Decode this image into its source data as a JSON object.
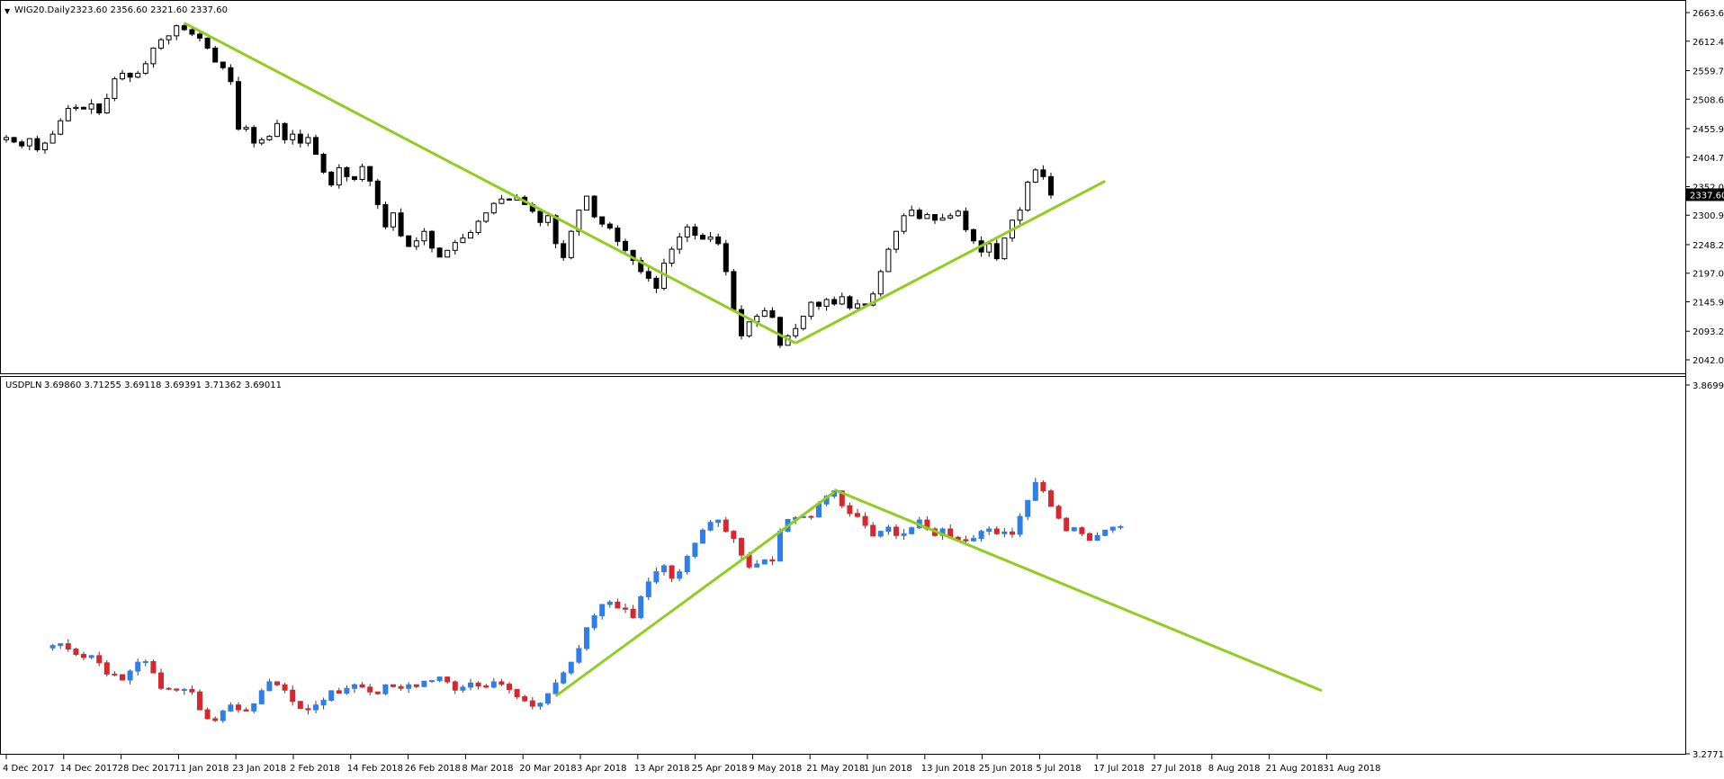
{
  "chart_data": [
    {
      "type": "candlestick",
      "title": "WIG20.Daily",
      "ohlc_text": "2323.60 2356.60 2321.60 2337.60",
      "current_price": "2337.60",
      "y_ticks": [
        "2663.60",
        "2612.45",
        "2559.70",
        "2508.60",
        "2455.90",
        "2404.75",
        "2352.05",
        "2300.90",
        "2248.20",
        "2197.05",
        "2145.90",
        "2093.20",
        "2042.05"
      ],
      "ylim": [
        2042.05,
        2663.6
      ],
      "bull_color": "#ffffff",
      "bear_color": "#000000",
      "trendline_color": "#8fce1f",
      "closes": [
        2440,
        2432,
        2425,
        2438,
        2418,
        2430,
        2446,
        2470,
        2492,
        2494,
        2491,
        2500,
        2484,
        2510,
        2545,
        2555,
        2548,
        2555,
        2572,
        2600,
        2615,
        2622,
        2640,
        2633,
        2625,
        2618,
        2600,
        2575,
        2565,
        2540,
        2455,
        2458,
        2430,
        2436,
        2442,
        2465,
        2436,
        2446,
        2430,
        2440,
        2410,
        2378,
        2355,
        2386,
        2370,
        2365,
        2388,
        2362,
        2320,
        2280,
        2305,
        2264,
        2245,
        2255,
        2272,
        2242,
        2226,
        2238,
        2252,
        2260,
        2270,
        2290,
        2305,
        2322,
        2330,
        2328,
        2333,
        2320,
        2308,
        2288,
        2300,
        2250,
        2225,
        2272,
        2310,
        2335,
        2298,
        2285,
        2278,
        2254,
        2238,
        2220,
        2200,
        2188,
        2170,
        2215,
        2240,
        2262,
        2280,
        2265,
        2258,
        2262,
        2250,
        2200,
        2132,
        2085,
        2110,
        2120,
        2130,
        2118,
        2068,
        2085,
        2098,
        2120,
        2145,
        2138,
        2150,
        2142,
        2155,
        2135,
        2142,
        2140,
        2160,
        2200,
        2240,
        2272,
        2300,
        2310,
        2295,
        2302,
        2292,
        2296,
        2300,
        2308,
        2275,
        2255,
        2235,
        2250,
        2223,
        2260,
        2292,
        2310,
        2360,
        2382,
        2370,
        2337
      ],
      "trendlines": [
        {
          "from": {
            "bar": 23,
            "price": 2645
          },
          "to": {
            "bar": 102,
            "price": 2072
          }
        },
        {
          "from": {
            "bar": 102,
            "price": 2072
          },
          "to": {
            "bar": 142,
            "price": 2362
          }
        }
      ]
    },
    {
      "type": "candlestick",
      "title": "USDPLN",
      "ohlc_text": "3.69860 3.71255 3.69118 3.69391 3.71362 3.69011",
      "y_ticks": [
        "3.86992",
        "3.27712"
      ],
      "ylim": [
        3.27712,
        3.86992
      ],
      "bull_color": "#2f7fe8",
      "bear_color": "#d8272d",
      "trendline_color": "#8fce1f",
      "closes": [
        3.438,
        3.441,
        3.432,
        3.423,
        3.418,
        3.421,
        3.409,
        3.39,
        3.389,
        3.38,
        3.395,
        3.41,
        3.411,
        3.392,
        3.366,
        3.365,
        3.363,
        3.364,
        3.36,
        3.33,
        3.315,
        3.312,
        3.328,
        3.338,
        3.33,
        3.328,
        3.34,
        3.362,
        3.377,
        3.372,
        3.363,
        3.344,
        3.332,
        3.33,
        3.338,
        3.346,
        3.362,
        3.358,
        3.366,
        3.372,
        3.368,
        3.36,
        3.357,
        3.372,
        3.369,
        3.366,
        3.372,
        3.369,
        3.378,
        3.379,
        3.385,
        3.377,
        3.363,
        3.368,
        3.375,
        3.37,
        3.368,
        3.377,
        3.373,
        3.364,
        3.352,
        3.345,
        3.336,
        3.341,
        3.357,
        3.375,
        3.392,
        3.41,
        3.433,
        3.468,
        3.488,
        3.507,
        3.511,
        3.501,
        3.499,
        3.485,
        3.52,
        3.545,
        3.562,
        3.572,
        3.551,
        3.562,
        3.588,
        3.61,
        3.632,
        3.645,
        3.649,
        3.63,
        3.618,
        3.59,
        3.57,
        3.575,
        3.582,
        3.58,
        3.63,
        3.65,
        3.653,
        3.655,
        3.654,
        3.676,
        3.689,
        3.698,
        3.673,
        3.66,
        3.655,
        3.64,
        3.622,
        3.63,
        3.637,
        3.623,
        3.626,
        3.636,
        3.649,
        3.634,
        3.623,
        3.634,
        3.62,
        3.616,
        3.614,
        3.618,
        3.63,
        3.634,
        3.626,
        3.629,
        3.625,
        3.655,
        3.682,
        3.712,
        3.698,
        3.672,
        3.652,
        3.631,
        3.636,
        3.626,
        3.615,
        3.623,
        3.632,
        3.637,
        3.638
      ],
      "trendlines": [
        {
          "from": {
            "bar": 65,
            "price": 3.353
          },
          "to": {
            "bar": 101,
            "price": 3.696
          }
        },
        {
          "from": {
            "bar": 101,
            "price": 3.7
          },
          "to": {
            "bar": 164,
            "price": 3.362
          }
        }
      ]
    }
  ],
  "x_axis": {
    "labels": [
      "4 Dec 2017",
      "14 Dec 2017",
      "28 Dec 2017",
      "11 Jan 2018",
      "23 Jan 2018",
      "2 Feb 2018",
      "14 Feb 2018",
      "26 Feb 2018",
      "8 Mar 2018",
      "20 Mar 2018",
      "3 Apr 2018",
      "13 Apr 2018",
      "25 Apr 2018",
      "9 May 2018",
      "21 May 2018",
      "1 Jun 2018",
      "13 Jun 2018",
      "25 Jun 2018",
      "5 Jul 2018",
      "17 Jul 2018",
      "27 Jul 2018",
      "8 Aug 2018",
      "21 Aug 2018",
      "31 Aug 2018"
    ]
  }
}
